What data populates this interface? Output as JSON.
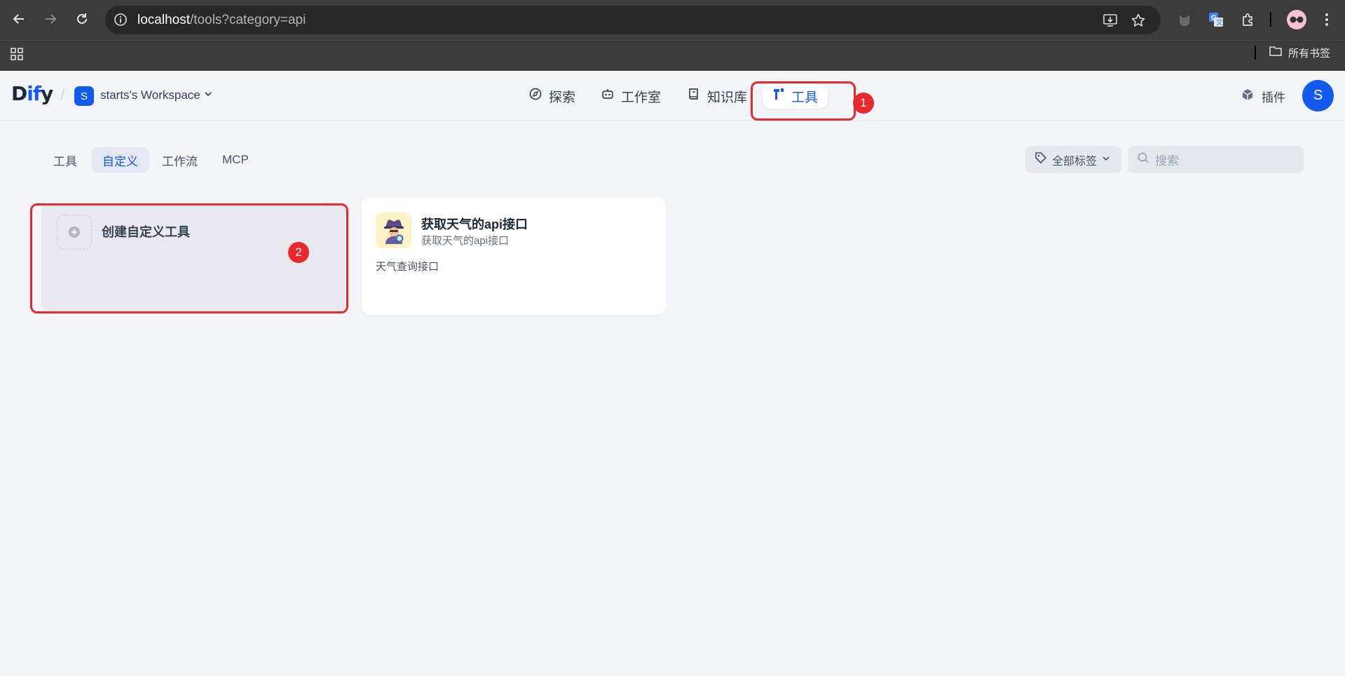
{
  "browser": {
    "url_host": "localhost",
    "url_path": "/tools?category=api",
    "bookmarks_folder": "所有书签"
  },
  "header": {
    "logo": {
      "part1": "D",
      "part2": "if",
      "part3": "y"
    },
    "workspace_initial": "S",
    "workspace_name": "starts's Workspace",
    "nav": [
      {
        "label": "探索",
        "icon": "compass-icon"
      },
      {
        "label": "工作室",
        "icon": "robot-icon"
      },
      {
        "label": "知识库",
        "icon": "book-icon"
      },
      {
        "label": "工具",
        "icon": "tool-icon",
        "active": true
      }
    ],
    "plugin_label": "插件",
    "avatar_initial": "S"
  },
  "annotations": {
    "first": "1",
    "second": "2"
  },
  "subtabs": [
    {
      "label": "工具"
    },
    {
      "label": "自定义",
      "active": true
    },
    {
      "label": "工作流"
    },
    {
      "label": "MCP"
    }
  ],
  "filters": {
    "tag_label": "全部标签",
    "search_placeholder": "搜索"
  },
  "cards": {
    "create_label": "创建自定义工具",
    "tool": {
      "title": "获取天气的api接口",
      "subtitle": "获取天气的api接口",
      "description": "天气查询接口",
      "icon": "detective-emoji"
    }
  },
  "colors": {
    "accent": "#155aef",
    "annotation": "#e8282b"
  }
}
